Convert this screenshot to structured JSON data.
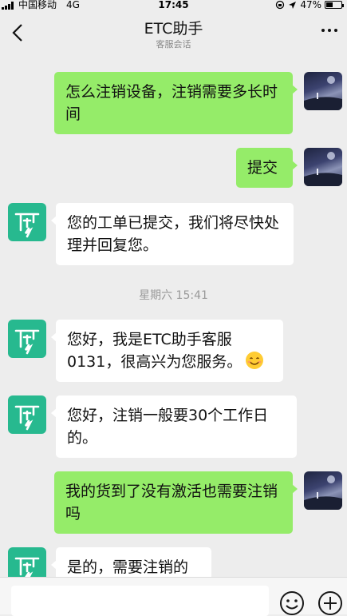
{
  "status_bar": {
    "carrier": "中国移动",
    "network": "4G",
    "time": "17:45",
    "battery": "47%",
    "battery_level": 0.47
  },
  "header": {
    "title": "ETC助手",
    "subtitle": "客服会话"
  },
  "messages": [
    {
      "sender": "me",
      "text": "怎么注销设备，注销需要多长时间"
    },
    {
      "sender": "me",
      "text": "提交"
    },
    {
      "sender": "service",
      "text": "您的工单已提交，我们将尽快处理并回复您。"
    },
    {
      "sender": "service",
      "text": "您好，我是ETC助手客服0131，很高兴为您服务。",
      "emoji": "smiling-face"
    },
    {
      "sender": "service",
      "text": "您好，注销一般要30个工作日的。"
    },
    {
      "sender": "me",
      "text": "我的货到了没有激活也需要注销吗"
    },
    {
      "sender": "service",
      "text": "是的，需要注销的"
    }
  ],
  "timestamp": "星期六 15:41",
  "icons": {
    "back": "chevron-left-icon",
    "more": "more-icon",
    "emoji": "emoji-icon",
    "plus": "plus-icon"
  },
  "colors": {
    "my_bubble": "#95ec69",
    "service_bubble": "#ffffff",
    "bot_avatar": "#27b98f",
    "background": "#ededed"
  }
}
